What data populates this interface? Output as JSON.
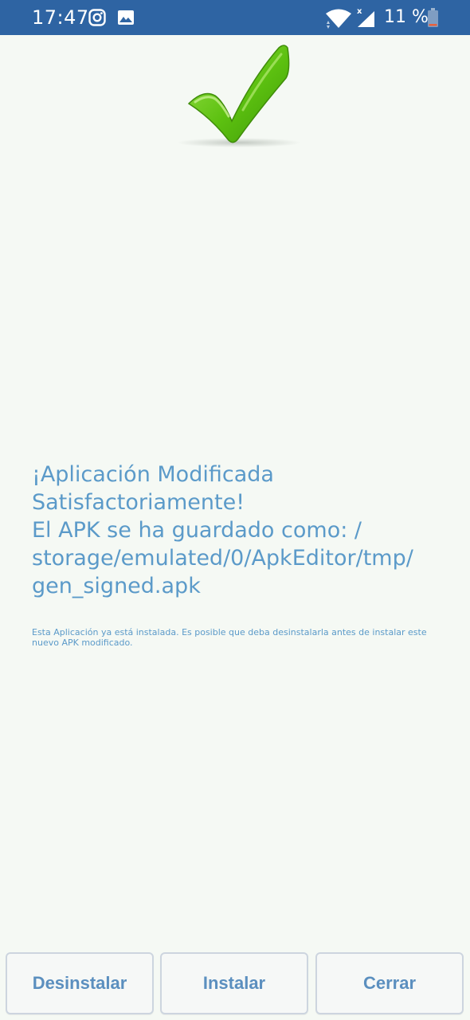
{
  "status_bar": {
    "time": "17:47",
    "battery_text": "11 %",
    "icons": [
      "instagram-icon",
      "image-icon",
      "wifi-icon",
      "signal-icon",
      "battery-icon"
    ]
  },
  "result": {
    "icon": "checkmark-icon",
    "message_lines": [
      "¡Aplicación Modificada",
      "Satisfactoriamente!",
      "El APK se ha guardado como: /",
      "storage/emulated/0/ApkEditor/tmp/",
      "gen_signed.apk"
    ],
    "note": "Esta Aplicación ya está instalada. Es posible que deba desinstalarla antes de instalar este nuevo APK modificado."
  },
  "buttons": {
    "uninstall": "Desinstalar",
    "install": "Instalar",
    "close": "Cerrar"
  },
  "colors": {
    "status_bar": "#2e64a3",
    "background": "#f5f9f4",
    "accent_text": "#5b9ac9",
    "check_green": "#5cc010"
  }
}
